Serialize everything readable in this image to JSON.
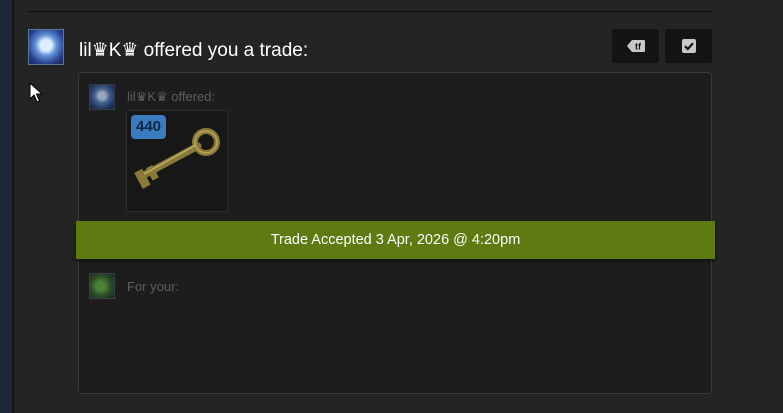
{
  "trade": {
    "heading": "lil♛K♛ offered you a trade:",
    "offered_label": "lil♛K♛ offered:",
    "item_count": "440",
    "status_banner": "Trade Accepted 3 Apr, 2026 @ 4:20pm",
    "your_label": "For your:"
  },
  "icons": {
    "tf_button": "tf-tag-icon",
    "accept_button": "checkmark-icon",
    "item": "mann-co-key-icon",
    "cursor": "mouse-pointer-icon"
  },
  "colors": {
    "banner": "#5e7b12",
    "count_badge": "#3b7cc1",
    "background": "#242424"
  }
}
